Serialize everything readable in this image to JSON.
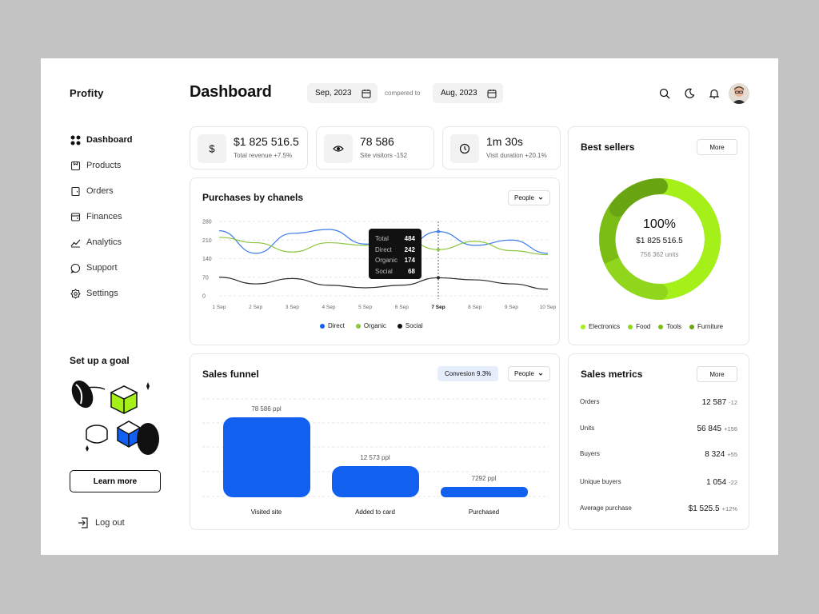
{
  "app": {
    "name": "Profity"
  },
  "header": {
    "title": "Dashboard",
    "date_from": "Sep, 2023",
    "compared_label": "compered to",
    "date_to": "Aug, 2023"
  },
  "sidebar": {
    "items": [
      {
        "label": "Dashboard",
        "icon": "grid-icon"
      },
      {
        "label": "Products",
        "icon": "box-icon"
      },
      {
        "label": "Orders",
        "icon": "order-icon"
      },
      {
        "label": "Finances",
        "icon": "wallet-icon"
      },
      {
        "label": "Analytics",
        "icon": "chart-line-icon"
      },
      {
        "label": "Support",
        "icon": "chat-icon"
      },
      {
        "label": "Settings",
        "icon": "gear-icon"
      }
    ],
    "active": "Dashboard",
    "goal_title": "Set up a goal",
    "learn_more": "Learn more",
    "logout": "Log out"
  },
  "stats": [
    {
      "value": "$1 825 516.5",
      "sub": "Total revenue +7.5%",
      "icon": "dollar-icon"
    },
    {
      "value": "78 586",
      "sub": "Site visitors -152",
      "icon": "eye-icon"
    },
    {
      "value": "1m 30s",
      "sub": "Visit duration +20.1%",
      "icon": "clock-icon"
    }
  ],
  "purchases": {
    "title": "Purchases by chanels",
    "filter": "People",
    "tooltip": {
      "rows": [
        {
          "k": "Total",
          "v": "484"
        },
        {
          "k": "Direct",
          "v": "242"
        },
        {
          "k": "Organic",
          "v": "174"
        },
        {
          "k": "Social",
          "v": "68"
        }
      ]
    },
    "legend": [
      "Direct",
      "Organic",
      "Social"
    ]
  },
  "chart_data": {
    "type": "line",
    "yticks": [
      "280",
      "210",
      "140",
      "70",
      "0"
    ],
    "ylim": [
      0,
      280
    ],
    "x": [
      "1 Sep",
      "2 Sep",
      "3 Sep",
      "4 Sep",
      "5 Sep",
      "6 Sep",
      "7 Sep",
      "8 Sep",
      "9 Sep",
      "10 Sep"
    ],
    "highlight": "7 Sep",
    "series": [
      {
        "name": "Direct",
        "color": "#3b7bea",
        "values": [
          245,
          160,
          235,
          250,
          195,
          180,
          242,
          190,
          210,
          160
        ]
      },
      {
        "name": "Organic",
        "color": "#8cc63f",
        "values": [
          220,
          200,
          165,
          200,
          190,
          215,
          174,
          205,
          170,
          155
        ]
      },
      {
        "name": "Social",
        "color": "#2b2b2b",
        "values": [
          70,
          45,
          65,
          40,
          30,
          40,
          68,
          60,
          45,
          25
        ]
      }
    ]
  },
  "best_sellers": {
    "title": "Best sellers",
    "more": "More",
    "percent": "100%",
    "amount": "$1 825 516.5",
    "units": "756 362 units",
    "legend": [
      {
        "name": "Electronics",
        "color": "#a6f01a"
      },
      {
        "name": "Food",
        "color": "#8fd61c"
      },
      {
        "name": "Tools",
        "color": "#7bbd14"
      },
      {
        "name": "Furniture",
        "color": "#69a512"
      }
    ]
  },
  "funnel": {
    "title": "Sales funnel",
    "conversion": "Convesion 9.3%",
    "filter": "People",
    "color": "#1260f0",
    "stages": [
      {
        "label": "Visited site",
        "value": "78 586 ppl"
      },
      {
        "label": "Added to card",
        "value": "12 573 ppl"
      },
      {
        "label": "Purchased",
        "value": "7292 ppl"
      }
    ]
  },
  "sales_metrics": {
    "title": "Sales metrics",
    "more": "More",
    "rows": [
      {
        "label": "Orders",
        "value": "12 587",
        "delta": "-12"
      },
      {
        "label": "Units",
        "value": "56 845",
        "delta": "+156"
      },
      {
        "label": "Buyers",
        "value": "8 324",
        "delta": "+55"
      },
      {
        "label": "Unique buyers",
        "value": "1 054",
        "delta": "-22"
      },
      {
        "label": "Average purchase",
        "value": "$1 525.5",
        "delta": "+12%"
      }
    ]
  }
}
